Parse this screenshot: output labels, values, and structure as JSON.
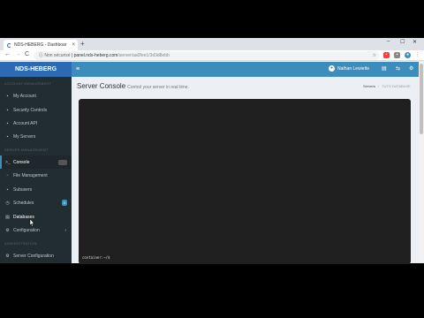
{
  "browser": {
    "tab_title": "NDS-HEBERG - Dashboar",
    "tab_close": "×",
    "new_tab": "+",
    "win_min": "–",
    "win_max": "☐",
    "win_close": "✕",
    "nav_back": "←",
    "nav_forward": "→",
    "nav_reload": "C",
    "not_secure": "Non sécurisé",
    "domain": "panel.nds-heberg.com",
    "path": "/server/aa0fee1/3d3d8ebb",
    "star": "☆"
  },
  "app": {
    "brand": "NDS-HEBERG",
    "menu_icon": "≡",
    "user_name": "Nathan Lewiette",
    "header_icons": [
      "server-icon",
      "share-icon",
      "gear-icon"
    ]
  },
  "sidebar": {
    "section_account": "ACCOUNT MANAGEMENT",
    "section_server": "SERVER MANAGEMENT",
    "section_admin": "ADMINISTRATION",
    "items": [
      {
        "label": "My Account",
        "icon": "user-icon",
        "glyph": "▪"
      },
      {
        "label": "Security Controls",
        "icon": "lock-icon",
        "glyph": "▪"
      },
      {
        "label": "Account API",
        "icon": "key-icon",
        "glyph": "▪"
      },
      {
        "label": "My Servers",
        "icon": "server-icon",
        "glyph": "▪"
      },
      {
        "label": "Console",
        "icon": "terminal-icon",
        "glyph": ">_"
      },
      {
        "label": "File Management",
        "icon": "file-icon",
        "glyph": "▫"
      },
      {
        "label": "Subusers",
        "icon": "users-icon",
        "glyph": "▪"
      },
      {
        "label": "Schedules",
        "icon": "clock-icon",
        "glyph": "◷",
        "badge": "0"
      },
      {
        "label": "Databases",
        "icon": "database-icon",
        "glyph": "▤"
      },
      {
        "label": "Configuration",
        "icon": "gear-icon",
        "glyph": "⚙",
        "chevron": "›"
      },
      {
        "label": "Server Configuration",
        "icon": "cog-icon",
        "glyph": "⚙"
      }
    ]
  },
  "content": {
    "title": "Server Console",
    "subtitle": "Control your server in real time.",
    "breadcrumb": [
      "Servers",
      "TUTO DATABASE"
    ],
    "prompt": "container:~/$"
  },
  "colors": {
    "brand": "#2c6bb3",
    "topnav": "#3c8dbc",
    "sidebar": "#222d32",
    "console": "#202020"
  }
}
